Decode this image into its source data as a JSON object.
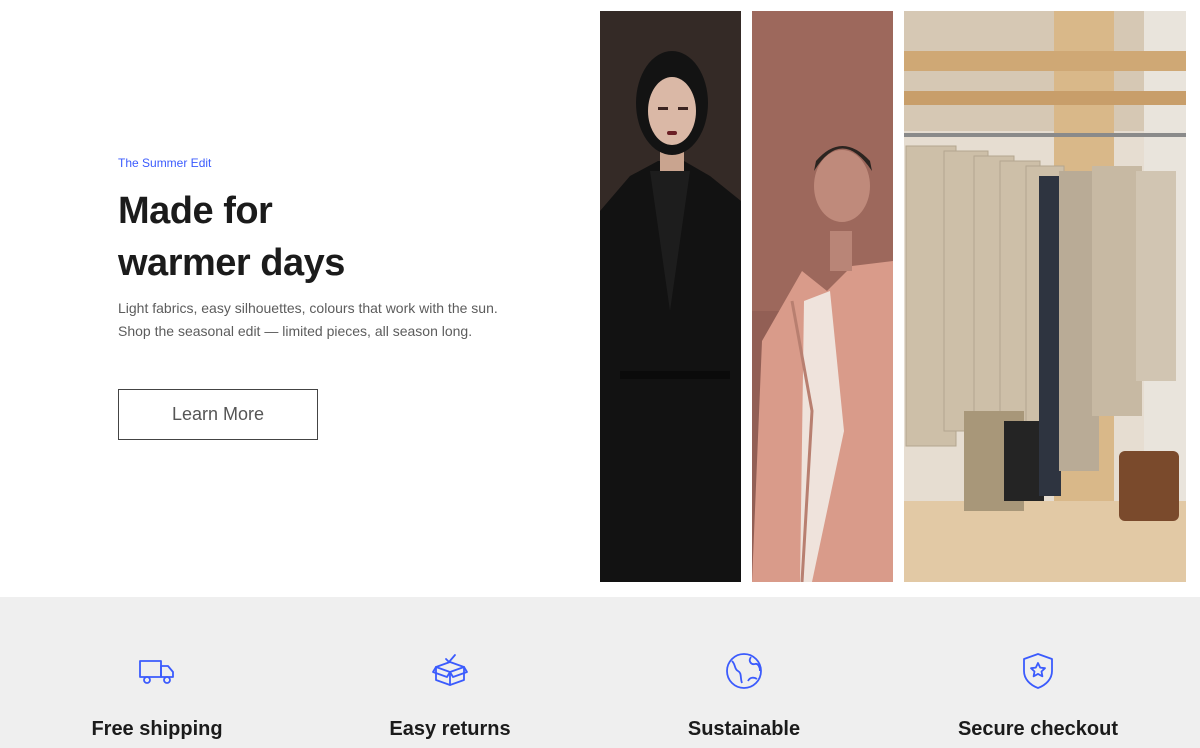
{
  "hero": {
    "eyebrow": "The Summer Edit",
    "title_line1": "Made for",
    "title_line2": "warmer days",
    "description": "Light fabrics, easy silhouettes, colours that work with the sun. Shop the seasonal edit — limited pieces, all season long.",
    "cta_label": "Learn More",
    "accent_color": "#3b5bfd"
  },
  "gallery": {
    "images": [
      {
        "icon": "woman-black-coat-photo"
      },
      {
        "icon": "man-pink-coat-photo"
      },
      {
        "icon": "clothing-rack-photo"
      }
    ]
  },
  "features": [
    {
      "icon": "truck-icon",
      "label": "Free shipping"
    },
    {
      "icon": "box-icon",
      "label": "Easy returns"
    },
    {
      "icon": "globe-icon",
      "label": "Sustainable"
    },
    {
      "icon": "shield-icon",
      "label": "Secure checkout"
    }
  ]
}
